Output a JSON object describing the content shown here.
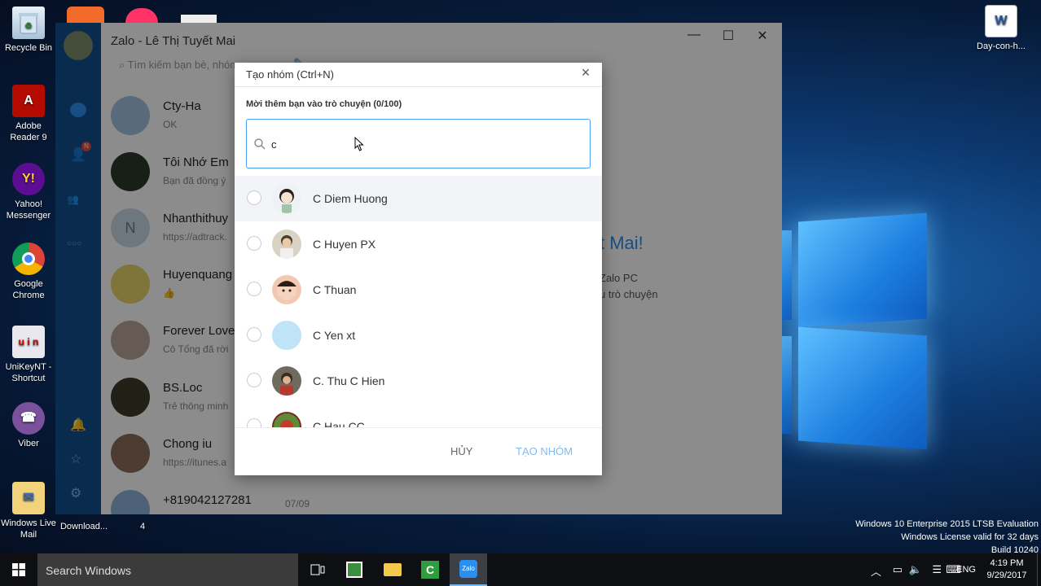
{
  "desktop": {
    "icons": [
      {
        "label": "Recycle Bin",
        "icon": "recycle-bin-icon"
      },
      {
        "label": "Adobe Reader 9",
        "icon": "adobe-reader-icon"
      },
      {
        "label": "Yahoo! Messenger",
        "icon": "yahoo-messenger-icon"
      },
      {
        "label": "Google Chrome",
        "icon": "chrome-icon"
      },
      {
        "label": "UniKeyNT - Shortcut",
        "icon": "unikey-icon"
      },
      {
        "label": "Viber",
        "icon": "viber-icon"
      },
      {
        "label": "Windows Live Mail",
        "icon": "mail-icon"
      },
      {
        "label": "Download...",
        "icon": "folder-icon"
      },
      {
        "label": "4",
        "icon": "file-icon"
      },
      {
        "label": "Day-con-h...",
        "icon": "word-doc-icon"
      }
    ]
  },
  "zalo": {
    "title": "Zalo - Lê Thị Tuyết Mai",
    "search_placeholder": "Tìm kiếm bạn bè, nhóm...",
    "conversations": [
      {
        "name": "Cty-Ha",
        "snippet": "OK"
      },
      {
        "name": "Tôi Nhớ Em",
        "snippet": "Bạn đã đồng ý"
      },
      {
        "name": "Nhanthithuy",
        "snippet": "https://adtrack.",
        "initial": "N"
      },
      {
        "name": "Huyenquang",
        "snippet": "👍"
      },
      {
        "name": "Forever Love",
        "snippet": "Cô Tống đã rời"
      },
      {
        "name": "BS.Loc",
        "snippet": "Trẻ thông minh"
      },
      {
        "name": "Chong iu",
        "snippet": "https://itunes.a"
      },
      {
        "name": "+819042127281",
        "snippet": "",
        "date": "07/09"
      }
    ],
    "welcome_title": "t Mai!",
    "welcome_line1": "Zalo PC",
    "welcome_line2": "u trò chuyện"
  },
  "dialog": {
    "title": "Tạo nhóm (Ctrl+N)",
    "subtitle": "Mời thêm bạn vào trò chuyện (0/100)",
    "search_value": "c",
    "contacts": [
      {
        "name": "C Diem Huong",
        "avatar_color": "#e9eef2",
        "highlighted": true
      },
      {
        "name": "C Huyen PX",
        "avatar_color": "#d8d3c2",
        "highlighted": false
      },
      {
        "name": "C Thuan",
        "avatar_color": "#f2c9b0",
        "highlighted": false
      },
      {
        "name": "C Yen xt",
        "avatar_color": "#bfe3f7",
        "highlighted": false
      },
      {
        "name": "C. Thu C Hien",
        "avatar_color": "#6f6a5e",
        "highlighted": false
      },
      {
        "name": "C Hau CC",
        "avatar_color": "#7a2b1e",
        "highlighted": false
      }
    ],
    "cancel_label": "HỦY",
    "create_label": "TẠO NHÓM"
  },
  "taskbar": {
    "search_placeholder": "Search Windows",
    "language": "ENG",
    "time": "4:19 PM",
    "date": "9/29/2017"
  },
  "watermark": {
    "line1": "Windows 10 Enterprise 2015 LTSB Evaluation",
    "line2": "Windows License valid for 32 days",
    "line3": "Build 10240"
  }
}
